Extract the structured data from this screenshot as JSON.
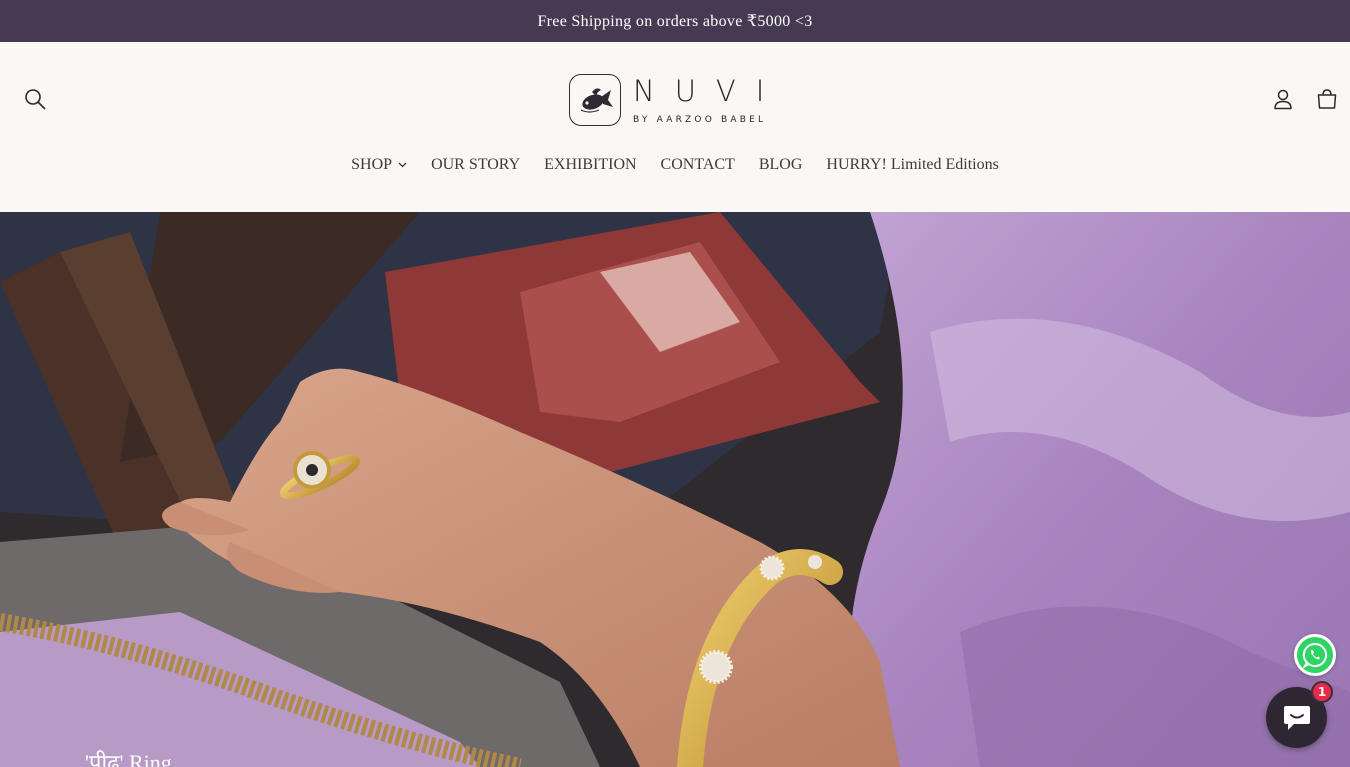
{
  "announcement": {
    "text": "Free Shipping on orders above ₹5000 <3"
  },
  "header": {
    "logo": {
      "word": "NUVI",
      "subtitle": "BY AARZOO BABEL"
    },
    "icons": {
      "search": "search-icon",
      "account": "user-icon",
      "cart": "cart-icon"
    },
    "nav": [
      {
        "label": "SHOP",
        "has_dropdown": true
      },
      {
        "label": "OUR STORY"
      },
      {
        "label": "EXHIBITION"
      },
      {
        "label": "CONTACT"
      },
      {
        "label": "BLOG"
      },
      {
        "label": "HURRY! Limited Editions"
      }
    ]
  },
  "hero": {
    "caption": "'पीढ' Ring"
  },
  "widgets": {
    "whatsapp_icon": "whatsapp-icon",
    "chat_icon": "chat-bubble-icon",
    "chat_badge": "1"
  },
  "colors": {
    "announcement_bg": "#463a52",
    "header_bg": "#faf8f5",
    "whatsapp": "#2fd366",
    "chat_bg": "#2f2633",
    "badge": "#e8294c"
  }
}
